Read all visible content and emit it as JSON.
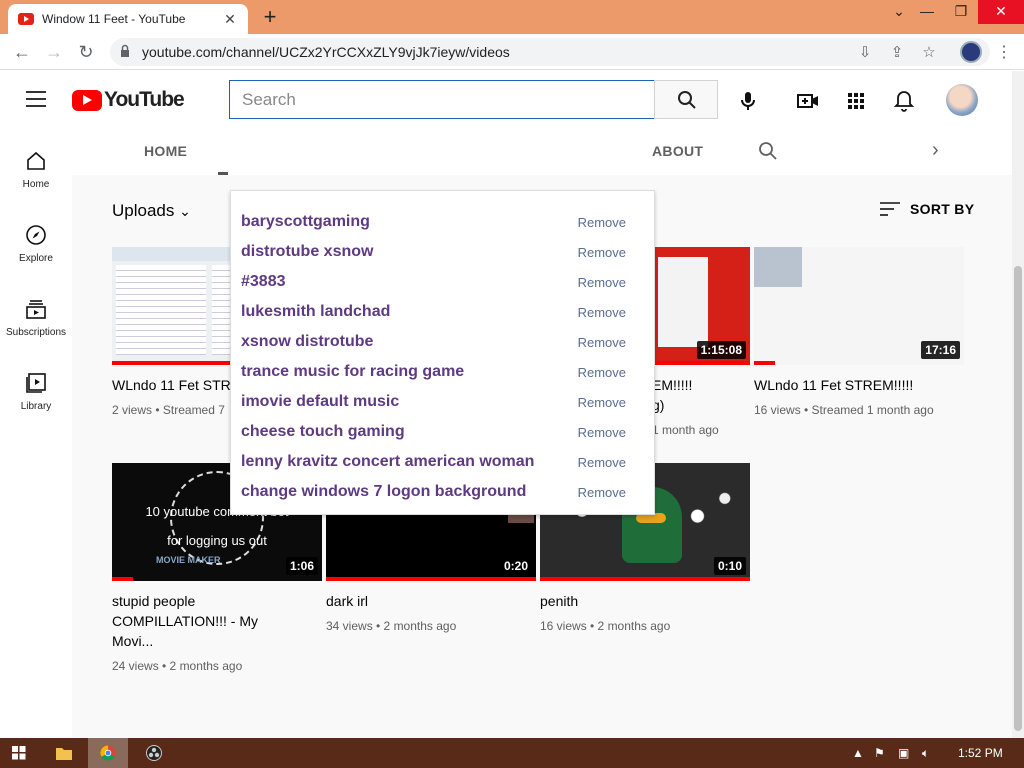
{
  "browser": {
    "tab_title": "Window 11 Feet - YouTube",
    "url": "youtube.com/channel/UCZx2YrCCXxZLY9vjJk7ieyw/videos"
  },
  "youtube": {
    "logo_text": "YouTube",
    "search_placeholder": "Search",
    "left_nav": [
      {
        "label": "Home",
        "icon": "home-icon"
      },
      {
        "label": "Explore",
        "icon": "compass-icon"
      },
      {
        "label": "Subscriptions",
        "icon": "subscriptions-icon"
      },
      {
        "label": "Library",
        "icon": "library-icon"
      }
    ],
    "channel_tabs": {
      "home": "HOME",
      "about": "ABOUT"
    },
    "uploads_label": "Uploads",
    "sort_label": "SORT BY",
    "suggestions": [
      {
        "query": "baryscottgaming",
        "action": "Remove"
      },
      {
        "query": "distrotube xsnow",
        "action": "Remove"
      },
      {
        "query": "#3883",
        "action": "Remove"
      },
      {
        "query": "lukesmith landchad",
        "action": "Remove"
      },
      {
        "query": "xsnow distrotube",
        "action": "Remove"
      },
      {
        "query": "trance music for racing game",
        "action": "Remove"
      },
      {
        "query": "imovie default music",
        "action": "Remove"
      },
      {
        "query": "cheese touch gaming",
        "action": "Remove"
      },
      {
        "query": "lenny kravitz concert american woman",
        "action": "Remove"
      },
      {
        "query": "change windows 7 logon background",
        "action": "Remove"
      }
    ],
    "videos": [
      {
        "title": "WLndo 11 Fet STR",
        "meta": "2 views • Streamed 7",
        "duration": "",
        "progress": 1.0
      },
      {
        "title": "EM!!!!!",
        "title2": "g)",
        "meta": "1 month ago",
        "duration": "1:15:08",
        "progress": 1.0
      },
      {
        "title": "WLndo 11 Fet STREM!!!!!",
        "meta": "16 views • Streamed 1 month ago",
        "duration": "17:16",
        "progress": 0.1
      },
      {
        "title": "stupid people COMPILLATION!!! - My Movi...",
        "meta": "24 views • 2 months ago",
        "duration": "1:06",
        "progress": 0.1,
        "overlay": "10 youtube comment bot\nfor logging us out",
        "badge": "MOVIE MAKER"
      },
      {
        "title": "dark irl",
        "meta": "34 views • 2 months ago",
        "duration": "0:20",
        "progress": 1.0
      },
      {
        "title": "penith",
        "meta": "16 views • 2 months ago",
        "duration": "0:10",
        "progress": 1.0
      }
    ]
  },
  "taskbar": {
    "time": "1:52 PM"
  },
  "colors": {
    "chrome_frame": "#ed9a6a",
    "youtube_red": "#ff0000",
    "suggestion_text": "#5d3a82",
    "taskbar": "#5a2a18"
  }
}
